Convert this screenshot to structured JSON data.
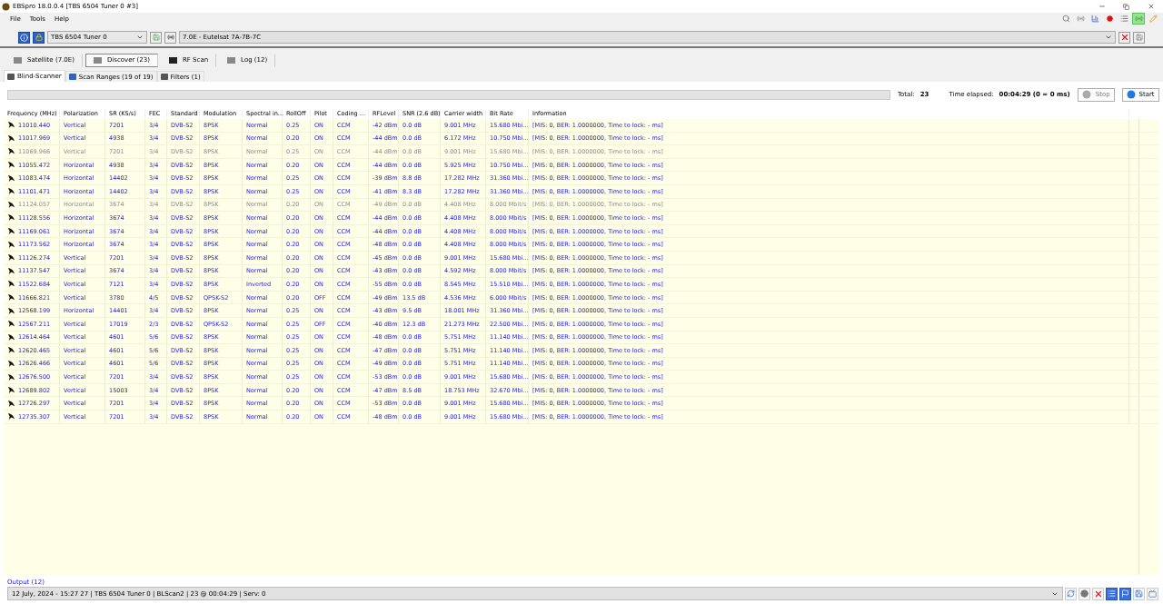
{
  "window": {
    "title": "EBSpro 18.0.0.4 [TBS 6504 Tuner 0 #3]"
  },
  "menu": [
    "File",
    "Tools",
    "Help"
  ],
  "top_tools": [
    {
      "selected": false
    },
    {
      "selected": false
    },
    {
      "selected": false
    },
    {
      "selected": false
    },
    {
      "selected": false
    },
    {
      "selected": true
    },
    {
      "selected": false
    }
  ],
  "tuner_select": {
    "value": "TBS 6504 Tuner 0"
  },
  "satellite_select": {
    "value": "7.0E - Eutelsat 7A-7B-7C"
  },
  "tabs": [
    {
      "label": "Satellite (7.0E)",
      "selected": false
    },
    {
      "label": "Discover (23)",
      "selected": true
    },
    {
      "label": "RF Scan",
      "selected": false
    },
    {
      "label": "Log (12)",
      "selected": false
    }
  ],
  "subtabs": [
    {
      "label": "Blind-Scanner",
      "selected": true
    },
    {
      "label": "Scan Ranges (19 of 19)",
      "selected": false
    },
    {
      "label": "Filters (1)",
      "selected": false
    }
  ],
  "progress": {
    "level": 0
  },
  "total": {
    "label": "Total:",
    "value": "23"
  },
  "elapsed": {
    "label": "Time elapsed:",
    "value": "00:04:29 (0 = 0 ms)"
  },
  "buttons": [
    {
      "label": "Stop",
      "disabled": true
    },
    {
      "label": "Start",
      "disabled": false
    }
  ],
  "table": {
    "columns": [
      "Frequency (MHz)",
      "Polarization",
      "SR (KS/s)",
      "FEC",
      "Standard",
      "Modulation",
      "Spectral in...",
      "RollOff",
      "Pilot",
      "Coding ...",
      "RFLevel",
      "SNR (2.6 dB)",
      "Carrier width",
      "Bit Rate",
      "Information"
    ],
    "rows": [
      {
        "dimmed": false,
        "cells": [
          "11010.440",
          "Vertical",
          "7201",
          "3/4",
          "DVB-S2",
          "8PSK",
          "Normal",
          "0.25",
          "ON",
          "CCM",
          "-42 dBm",
          "0.0 dB",
          "9.001 MHz",
          "15.680 Mbi...",
          "[MIS: 0, BER: 1.0000000, Time to lock: - ms]"
        ]
      },
      {
        "dimmed": false,
        "cells": [
          "11017.969",
          "Vertical",
          "4938",
          "3/4",
          "DVB-S2",
          "8PSK",
          "Normal",
          "0.20",
          "ON",
          "CCM",
          "-44 dBm",
          "0.0 dB",
          "6.172 MHz",
          "10.750 Mbi...",
          "[MIS: 0, BER: 1.0000000, Time to lock: - ms]"
        ]
      },
      {
        "dimmed": true,
        "cells": [
          "11069.966",
          "Vertical",
          "7201",
          "3/4",
          "DVB-S2",
          "8PSK",
          "Normal",
          "0.25",
          "ON",
          "CCM",
          "-44 dBm",
          "0.0 dB",
          "9.001 MHz",
          "15.680 Mbi...",
          "[MIS: 0, BER: 1.0000000, Time to lock: - ms]"
        ]
      },
      {
        "dimmed": false,
        "cells": [
          "11055.472",
          "Horizontal",
          "4938",
          "3/4",
          "DVB-S2",
          "8PSK",
          "Normal",
          "0.20",
          "ON",
          "CCM",
          "-44 dBm",
          "0.0 dB",
          "5.925 MHz",
          "10.750 Mbi...",
          "[MIS: 0, BER: 1.0000000, Time to lock: - ms]"
        ]
      },
      {
        "dimmed": false,
        "cells": [
          "11083.474",
          "Horizontal",
          "14402",
          "3/4",
          "DVB-S2",
          "8PSK",
          "Normal",
          "0.25",
          "ON",
          "CCM",
          "-39 dBm",
          "8.8 dB",
          "17.282 MHz",
          "31.360 Mbi...",
          "[MIS: 0, BER: 1.0000000, Time to lock: - ms]"
        ]
      },
      {
        "dimmed": false,
        "cells": [
          "11101.471",
          "Horizontal",
          "14402",
          "3/4",
          "DVB-S2",
          "8PSK",
          "Normal",
          "0.25",
          "ON",
          "CCM",
          "-41 dBm",
          "8.3 dB",
          "17.282 MHz",
          "31.360 Mbi...",
          "[MIS: 0, BER: 1.0000000, Time to lock: - ms]"
        ]
      },
      {
        "dimmed": true,
        "cells": [
          "11124.057",
          "Horizontal",
          "3674",
          "3/4",
          "DVB-S2",
          "8PSK",
          "Normal",
          "0.20",
          "ON",
          "CCM",
          "-49 dBm",
          "0.0 dB",
          "4.408 MHz",
          "8.000 Mbit/s",
          "[MIS: 0, BER: 1.0000000, Time to lock: - ms]"
        ]
      },
      {
        "dimmed": false,
        "cells": [
          "11128.556",
          "Horizontal",
          "3674",
          "3/4",
          "DVB-S2",
          "8PSK",
          "Normal",
          "0.20",
          "ON",
          "CCM",
          "-44 dBm",
          "0.0 dB",
          "4.408 MHz",
          "8.000 Mbit/s",
          "[MIS: 0, BER: 1.0000000, Time to lock: - ms]"
        ]
      },
      {
        "dimmed": false,
        "cells": [
          "11169.061",
          "Horizontal",
          "3674",
          "3/4",
          "DVB-S2",
          "8PSK",
          "Normal",
          "0.20",
          "ON",
          "CCM",
          "-44 dBm",
          "0.0 dB",
          "4.408 MHz",
          "8.000 Mbit/s",
          "[MIS: 0, BER: 1.0000000, Time to lock: - ms]"
        ]
      },
      {
        "dimmed": false,
        "cells": [
          "11173.562",
          "Horizontal",
          "3674",
          "3/4",
          "DVB-S2",
          "8PSK",
          "Normal",
          "0.20",
          "ON",
          "CCM",
          "-48 dBm",
          "0.0 dB",
          "4.408 MHz",
          "8.000 Mbit/s",
          "[MIS: 0, BER: 1.0000000, Time to lock: - ms]"
        ]
      },
      {
        "dimmed": false,
        "cells": [
          "11126.274",
          "Vertical",
          "7201",
          "3/4",
          "DVB-S2",
          "8PSK",
          "Normal",
          "0.20",
          "ON",
          "CCM",
          "-45 dBm",
          "0.0 dB",
          "9.001 MHz",
          "15.680 Mbi...",
          "[MIS: 0, BER: 1.0000000, Time to lock: - ms]"
        ]
      },
      {
        "dimmed": false,
        "cells": [
          "11137.547",
          "Vertical",
          "3674",
          "3/4",
          "DVB-S2",
          "8PSK",
          "Normal",
          "0.20",
          "ON",
          "CCM",
          "-43 dBm",
          "0.0 dB",
          "4.592 MHz",
          "8.000 Mbit/s",
          "[MIS: 0, BER: 1.0000000, Time to lock: - ms]"
        ]
      },
      {
        "dimmed": false,
        "cells": [
          "11522.684",
          "Vertical",
          "7121",
          "3/4",
          "DVB-S2",
          "8PSK",
          "Inverted",
          "0.20",
          "ON",
          "CCM",
          "-55 dBm",
          "0.0 dB",
          "8.545 MHz",
          "15.510 Mbi...",
          "[MIS: 0, BER: 1.0000000, Time to lock: - ms]"
        ]
      },
      {
        "dimmed": false,
        "cells": [
          "11666.821",
          "Vertical",
          "3780",
          "4/5",
          "DVB-S2",
          "QPSK-S2",
          "Normal",
          "0.20",
          "OFF",
          "CCM",
          "-49 dBm",
          "13.5 dB",
          "4.536 MHz",
          "6.000 Mbit/s",
          "[MIS: 0, BER: 1.0000000, Time to lock: - ms]"
        ]
      },
      {
        "dimmed": false,
        "cells": [
          "12568.199",
          "Horizontal",
          "14401",
          "3/4",
          "DVB-S2",
          "8PSK",
          "Normal",
          "0.25",
          "ON",
          "CCM",
          "-43 dBm",
          "9.5 dB",
          "18.001 MHz",
          "31.360 Mbi...",
          "[MIS: 0, BER: 1.0000000, Time to lock: - ms]"
        ]
      },
      {
        "dimmed": false,
        "cells": [
          "12567.211",
          "Vertical",
          "17019",
          "2/3",
          "DVB-S2",
          "QPSK-S2",
          "Normal",
          "0.25",
          "OFF",
          "CCM",
          "-40 dBm",
          "12.3 dB",
          "21.273 MHz",
          "22.500 Mbi...",
          "[MIS: 0, BER: 1.0000000, Time to lock: - ms]"
        ]
      },
      {
        "dimmed": false,
        "cells": [
          "12614.464",
          "Vertical",
          "4601",
          "5/6",
          "DVB-S2",
          "8PSK",
          "Normal",
          "0.25",
          "ON",
          "CCM",
          "-48 dBm",
          "0.0 dB",
          "5.751 MHz",
          "11.140 Mbi...",
          "[MIS: 0, BER: 1.0000000, Time to lock: - ms]"
        ]
      },
      {
        "dimmed": false,
        "cells": [
          "12620.465",
          "Vertical",
          "4601",
          "5/6",
          "DVB-S2",
          "8PSK",
          "Normal",
          "0.25",
          "ON",
          "CCM",
          "-47 dBm",
          "0.0 dB",
          "5.751 MHz",
          "11.140 Mbi...",
          "[MIS: 0, BER: 1.0000000, Time to lock: - ms]"
        ]
      },
      {
        "dimmed": false,
        "cells": [
          "12626.466",
          "Vertical",
          "4601",
          "5/6",
          "DVB-S2",
          "8PSK",
          "Normal",
          "0.25",
          "ON",
          "CCM",
          "-49 dBm",
          "0.0 dB",
          "5.751 MHz",
          "11.140 Mbi...",
          "[MIS: 0, BER: 1.0000000, Time to lock: - ms]"
        ]
      },
      {
        "dimmed": false,
        "cells": [
          "12676.500",
          "Vertical",
          "7201",
          "3/4",
          "DVB-S2",
          "8PSK",
          "Normal",
          "0.25",
          "ON",
          "CCM",
          "-53 dBm",
          "0.0 dB",
          "9.001 MHz",
          "15.680 Mbi...",
          "[MIS: 0, BER: 1.0000000, Time to lock: - ms]"
        ]
      },
      {
        "dimmed": false,
        "cells": [
          "12689.802",
          "Vertical",
          "15003",
          "3/4",
          "DVB-S2",
          "8PSK",
          "Normal",
          "0.20",
          "ON",
          "CCM",
          "-47 dBm",
          "8.5 dB",
          "18.753 MHz",
          "32.670 Mbi...",
          "[MIS: 0, BER: 1.0000000, Time to lock: - ms]"
        ]
      },
      {
        "dimmed": false,
        "cells": [
          "12726.297",
          "Vertical",
          "7201",
          "3/4",
          "DVB-S2",
          "8PSK",
          "Normal",
          "0.20",
          "ON",
          "CCM",
          "-53 dBm",
          "0.0 dB",
          "9.001 MHz",
          "15.680 Mbi...",
          "[MIS: 0, BER: 1.0000000, Time to lock: - ms]"
        ]
      },
      {
        "dimmed": false,
        "cells": [
          "12735.307",
          "Vertical",
          "7201",
          "3/4",
          "DVB-S2",
          "8PSK",
          "Normal",
          "0.20",
          "ON",
          "CCM",
          "-48 dBm",
          "0.0 dB",
          "9.001 MHz",
          "15.680 Mbi...",
          "[MIS: 0, BER: 1.0000000, Time to lock: - ms]"
        ]
      }
    ]
  },
  "output": {
    "label": "Output (12)",
    "value": "12 July, 2024 - 15:27 27 | TBS 6504 Tuner 0 | BLScan2 | 23 @ 00:04:29 | Serv: 0"
  },
  "output_tools": [
    {
      "selected": false
    },
    {
      "selected": false
    },
    {
      "selected": false
    },
    {
      "selected": true
    },
    {
      "selected": true
    },
    {
      "selected": false
    },
    {
      "selected": false
    }
  ]
}
